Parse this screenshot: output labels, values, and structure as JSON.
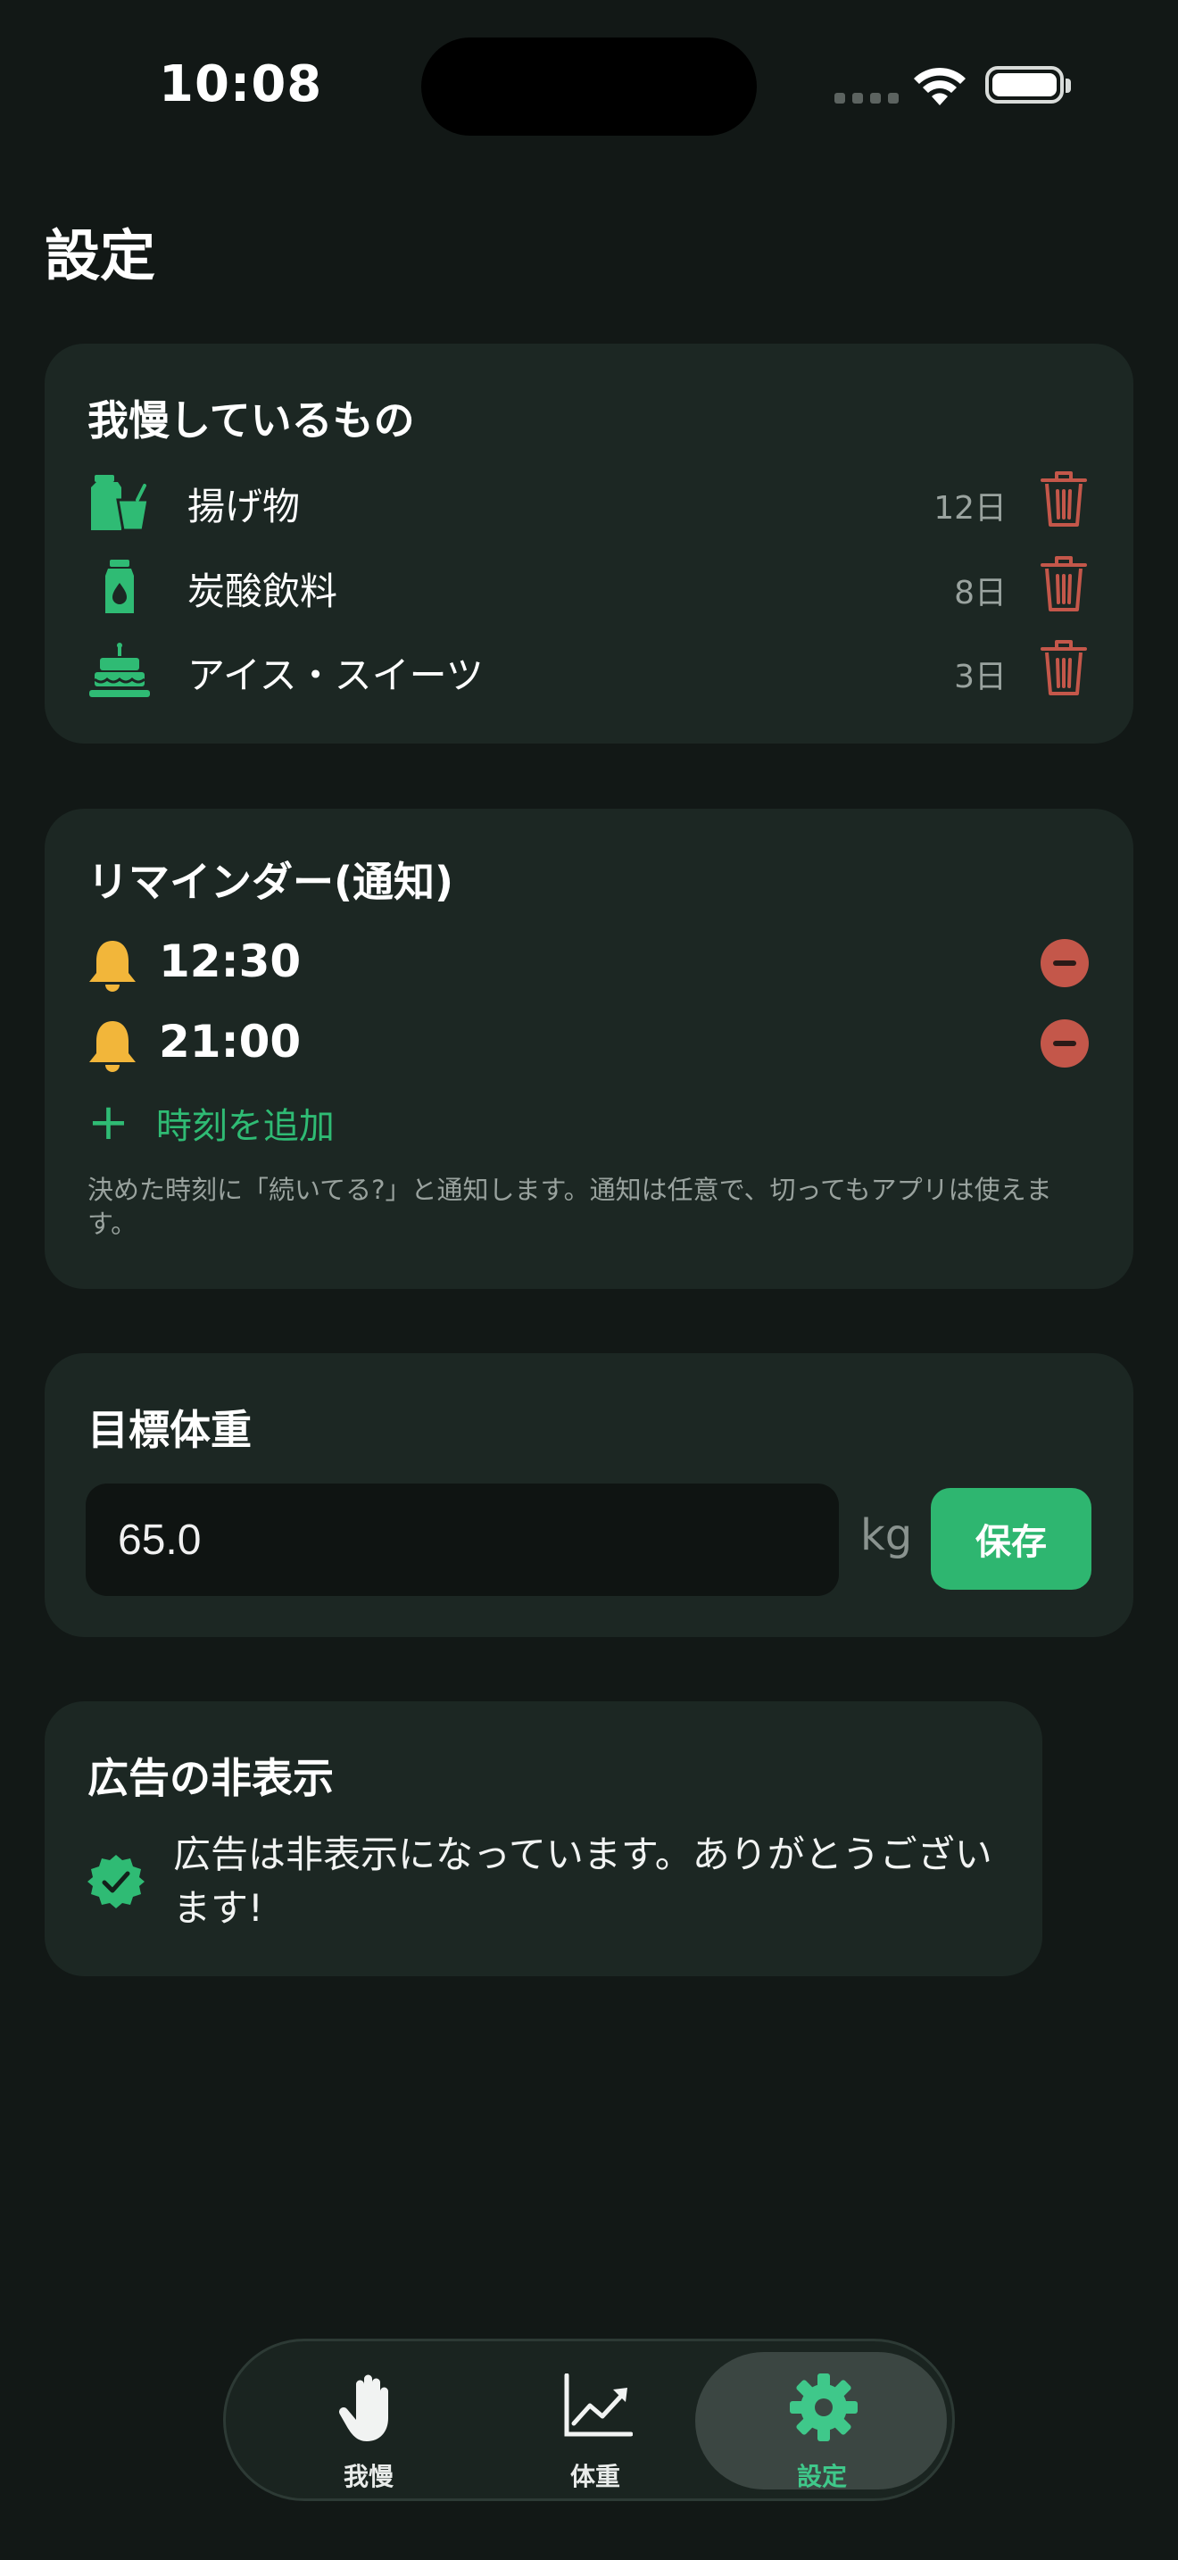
{
  "status": {
    "time": "10:08"
  },
  "page": {
    "title": "設定"
  },
  "gaman": {
    "title": "我慢しているもの",
    "items": [
      {
        "label": "揚げ物",
        "days": "12日",
        "icon": "fries-drink-icon"
      },
      {
        "label": "炭酸飲料",
        "days": "8日",
        "icon": "bottle-icon"
      },
      {
        "label": "アイス・スイーツ",
        "days": "3日",
        "icon": "cake-icon"
      }
    ]
  },
  "reminder": {
    "title": "リマインダー(通知)",
    "times": [
      "12:30",
      "21:00"
    ],
    "add_label": "時刻を追加",
    "note": "決めた時刻に「続いてる?」と通知します。通知は任意で、切ってもアプリは使えます。"
  },
  "weight": {
    "title": "目標体重",
    "value": "65.0",
    "unit": "kg",
    "save_label": "保存"
  },
  "ads": {
    "title": "広告の非表示",
    "message": "広告は非表示になっています。ありがとうございます!"
  },
  "tabs": [
    {
      "label": "我慢",
      "icon": "hand-icon"
    },
    {
      "label": "体重",
      "icon": "chart-icon"
    },
    {
      "label": "設定",
      "icon": "gear-icon",
      "active": true
    }
  ],
  "colors": {
    "background": "#121816",
    "card": "#1c2723",
    "accent_green": "#2eb670",
    "bell_yellow": "#f2b63a",
    "delete_red": "#c4574a"
  }
}
